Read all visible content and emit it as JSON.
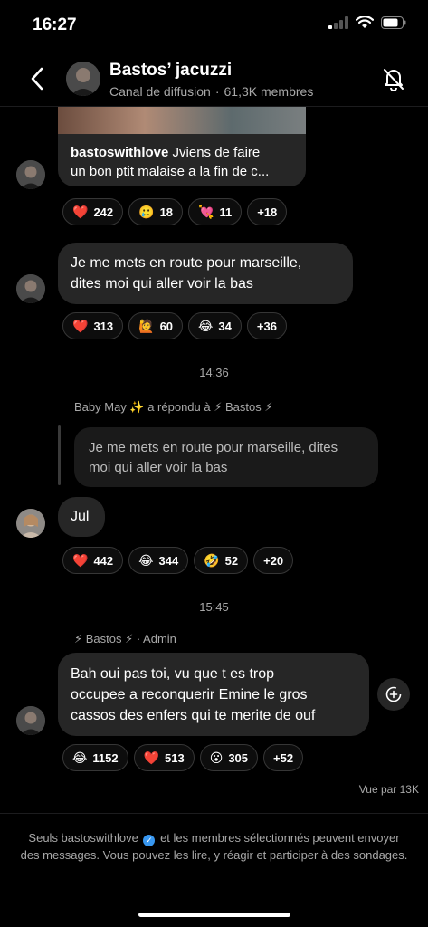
{
  "status_bar": {
    "time": "16:27"
  },
  "header": {
    "title": "Bastos’ jacuzzi",
    "subtitle_type": "Canal de diffusion",
    "subtitle_members": "61,3K membres",
    "icons": {
      "back": "chevron-left-icon",
      "mute": "bell-slash-icon"
    }
  },
  "messages": {
    "post": {
      "username": "bastoswithlove",
      "line1": "Jviens de faire",
      "line2": "un bon ptit malaise a la fin de c...",
      "reactions": [
        {
          "emoji": "❤️",
          "count": "242"
        },
        {
          "emoji": "🥲",
          "count": "18"
        },
        {
          "emoji": "💘",
          "count": "11"
        },
        {
          "emoji": "",
          "count": "+18"
        }
      ]
    },
    "msg2": {
      "line1": "Je me mets en route pour marseille,",
      "line2": "dites moi qui aller voir la bas",
      "reactions": [
        {
          "emoji": "❤️",
          "count": "313"
        },
        {
          "emoji": "🙋",
          "count": "60"
        },
        {
          "emoji": "😂",
          "count": "34"
        },
        {
          "emoji": "",
          "count": "+36"
        }
      ]
    },
    "time1": "14:36",
    "reply": {
      "label": "Baby May ✨ a répondu à ⚡ Bastos ⚡",
      "quote_line1": "Je me mets en route pour marseille, dites",
      "quote_line2": "moi qui aller voir la bas",
      "text": "Jul",
      "reactions": [
        {
          "emoji": "❤️",
          "count": "442"
        },
        {
          "emoji": "😂",
          "count": "344"
        },
        {
          "emoji": "🤣",
          "count": "52"
        },
        {
          "emoji": "",
          "count": "+20"
        }
      ]
    },
    "time2": "15:45",
    "admin": {
      "label": "⚡ Bastos ⚡ · Admin",
      "line1": "Bah oui pas toi, vu que t es trop",
      "line2": "occupee a reconquerir Emine le gros",
      "line3": "cassos des enfers qui te merite de ouf",
      "reactions": [
        {
          "emoji": "😂",
          "count": "1152"
        },
        {
          "emoji": "❤️",
          "count": "513"
        },
        {
          "emoji": "😮",
          "count": "305"
        },
        {
          "emoji": "",
          "count": "+52"
        }
      ]
    },
    "seen": "Vue par 13K"
  },
  "footer": {
    "part1": "Seuls bastoswithlove",
    "part2": "et les membres sélectionnés peuvent envoyer des messages. Vous pouvez les lire, y réagir et participer à des sondages."
  },
  "colors": {
    "background": "#000000",
    "bubble": "#262626",
    "secondary_text": "#a8a8a8",
    "verified": "#3897f0"
  }
}
